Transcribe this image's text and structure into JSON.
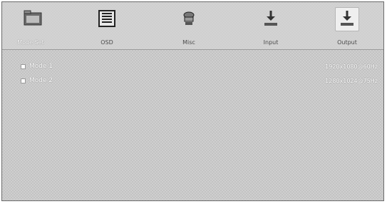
{
  "toolbar": {
    "items": [
      {
        "label": "Mode Set",
        "icon": "folder-icon"
      },
      {
        "label": "OSD",
        "icon": "grid-icon"
      },
      {
        "label": "Misc",
        "icon": "stack-icon"
      },
      {
        "label": "Input",
        "icon": "input-arrow-icon"
      },
      {
        "label": "Output",
        "icon": "output-arrow-icon"
      }
    ]
  },
  "list": {
    "rows": [
      {
        "name": "Mode 1",
        "value": "1920x1080@60Hz"
      },
      {
        "name": "Mode 2",
        "value": "1280x1024@75Hz"
      }
    ]
  },
  "colors": {
    "accent": "#3a3a3a"
  }
}
